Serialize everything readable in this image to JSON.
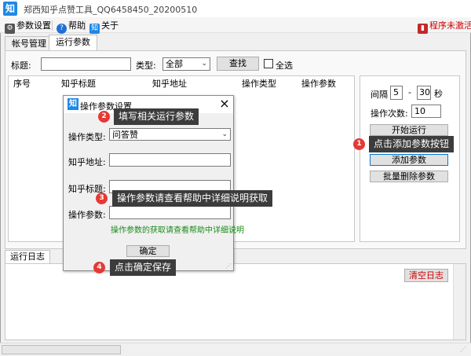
{
  "window": {
    "title": "郑西知乎点赞工具_QQ6458450_20200510",
    "icon_glyph": "知"
  },
  "menu": {
    "items": [
      {
        "label": "参数设置",
        "icon": "settings-icon"
      },
      {
        "label": "帮助",
        "icon": "help-icon"
      },
      {
        "label": "关于",
        "icon": "about-icon"
      }
    ],
    "activation_label": "程序未激活"
  },
  "tabs": [
    {
      "label": "帐号管理",
      "active": false
    },
    {
      "label": "运行参数",
      "active": true
    }
  ],
  "filter": {
    "title_label": "标题:",
    "title_value": "",
    "type_label": "类型:",
    "type_value": "全部",
    "search_label": "查找",
    "select_all_label": "全选"
  },
  "grid": {
    "columns": [
      "序号",
      "知乎标题",
      "知乎地址",
      "操作类型",
      "操作参数"
    ]
  },
  "controls": {
    "interval_label": "间隔",
    "interval_min": "5",
    "interval_dash": "-",
    "interval_max": "30",
    "interval_unit": "秒",
    "count_label": "操作次数:",
    "count_value": "10",
    "start_label": "开始运行",
    "add_label": "添加参数",
    "batch_delete_label": "批量删除参数"
  },
  "log": {
    "tab_label": "运行日志",
    "clear_label": "清空日志"
  },
  "dialog": {
    "title": "操作参数设置",
    "close_glyph": "×",
    "type_label": "操作类型:",
    "type_value": "问答赞",
    "url_label": "知乎地址:",
    "url_value": "",
    "title_label": "知乎标题:",
    "title_value": "",
    "param_label": "操作参数:",
    "param_value": "",
    "hint": "操作参数的获取请查看帮助中详细说明",
    "ok_label": "确定"
  },
  "callouts": [
    {
      "num": "1",
      "text": "点击添加参数按钮"
    },
    {
      "num": "2",
      "text": "填写相关运行参数"
    },
    {
      "num": "3",
      "text": "操作参数请查看帮助中详细说明获取"
    },
    {
      "num": "4",
      "text": "点击确定保存"
    }
  ],
  "colors": {
    "accent_blue": "#1e88e5",
    "callout_bg": "#3c3c3c",
    "badge_red": "#e53935",
    "hint_green": "#1a8c1a",
    "warning_red": "#d00000"
  }
}
